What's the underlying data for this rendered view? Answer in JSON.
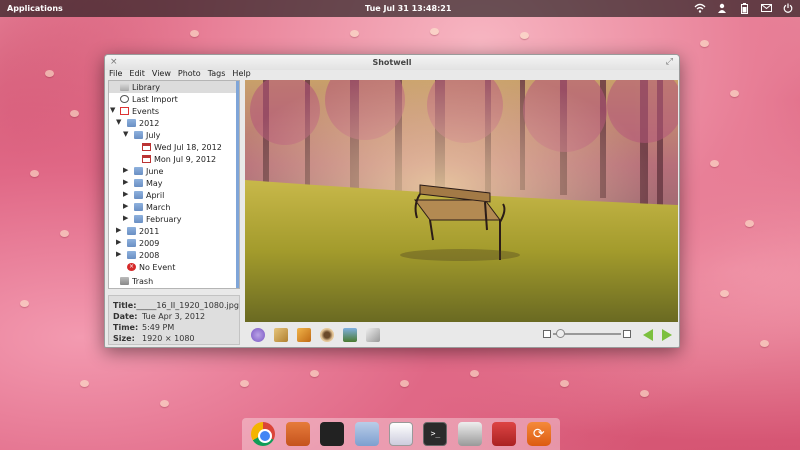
{
  "top_panel": {
    "applications": "Applications",
    "clock": "Tue Jul 31 13:48:21",
    "tray_icons": [
      "wifi-icon",
      "user-icon",
      "battery-icon",
      "mail-icon",
      "power-icon"
    ]
  },
  "window": {
    "title": "Shotwell",
    "close_glyph": "×",
    "maximize_glyph": "⤢",
    "menu": [
      "File",
      "Edit",
      "View",
      "Photo",
      "Tags",
      "Help"
    ]
  },
  "sidebar": {
    "library": "Library",
    "last_import": "Last Import",
    "events": "Events",
    "year_2012": "2012",
    "july": "July",
    "wed_jul_18": "Wed Jul 18, 2012",
    "mon_jul_9": "Mon Jul 9, 2012",
    "june": "June",
    "may": "May",
    "april": "April",
    "march": "March",
    "february": "February",
    "year_2011": "2011",
    "year_2009": "2009",
    "year_2008": "2008",
    "no_event": "No Event",
    "trash": "Trash"
  },
  "info": {
    "title_key": "Title:",
    "title_val": "_____16_II_1920_1080.jpg",
    "date_key": "Date:",
    "date_val": "Tue Apr 3, 2012",
    "time_key": "Time:",
    "time_val": "5:49 PM",
    "size_key": "Size:",
    "size_val": "1920 × 1080"
  },
  "toolbar": {
    "tools": [
      "rotate-icon",
      "crop-icon",
      "enhance-icon",
      "red-eye-icon",
      "adjust-icon",
      "straighten-icon"
    ],
    "zoom_level": 0.05
  },
  "colors": {
    "accent_green": "#7cc03e",
    "selection": "#dcdcdc",
    "scroll": "#7fa5d8"
  }
}
